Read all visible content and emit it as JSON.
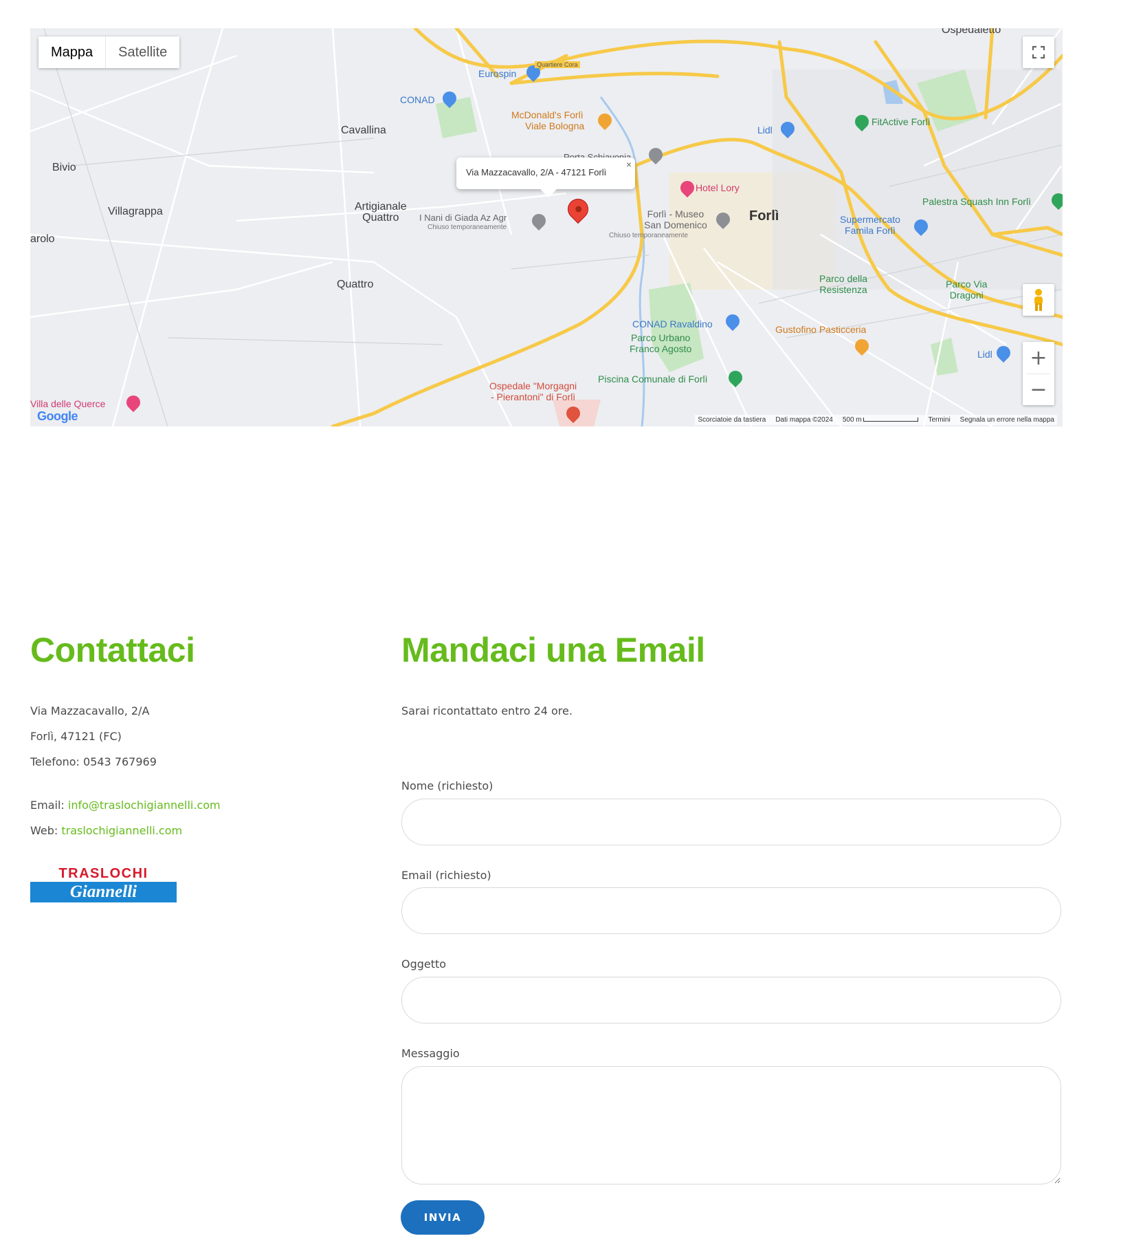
{
  "map": {
    "type_buttons": {
      "map": "Mappa",
      "satellite": "Satellite"
    },
    "info_window": "Via Mazzacavallo, 2/A - 47121 Forlì",
    "close_glyph": "×",
    "labels": {
      "ospedaletto": "Ospedaletto",
      "eurospin": "Eurospin",
      "conad": "CONAD",
      "mcdonalds_1": "McDonald's Forlì",
      "mcdonalds_2": "Viale Bologna",
      "cavallina": "Cavallina",
      "bivio": "Bivio",
      "villagrappa": "Villagrappa",
      "artigianale_1": "Artigianale",
      "artigianale_2": "Quattro",
      "nani": "I Nani di Giada Az Agr",
      "nani_sub": "Chiuso temporaneamente",
      "arolo": "arolo",
      "quattro": "Quattro",
      "porta": "Porta Schiavonia",
      "lidl_1": "Lidl",
      "fitactive": "FitActive Forlì",
      "hotel_lory": "Hotel Lory",
      "forli": "Forlì",
      "museo_1": "Forlì - Museo",
      "museo_2": "San Domenico",
      "museo_sub": "Chiuso temporaneamente",
      "palestra": "Palestra Squash Inn Forlì",
      "supermercato_1": "Supermercato",
      "supermercato_2": "Famila Forlì",
      "parco_res_1": "Parco della",
      "parco_res_2": "Resistenza",
      "parco_via_1": "Parco Via",
      "parco_via_2": "Dragoni",
      "conad_raval": "CONAD Ravaldino",
      "parco_urbano_1": "Parco Urbano",
      "parco_urbano_2": "Franco Agosto",
      "gustofino": "Gustofino Pasticceria",
      "lidl_2": "Lidl",
      "piscina": "Piscina Comunale di Forlì",
      "ospedale_1": "Ospedale \"Morgagni",
      "ospedale_2": "- Pierantoni\" di Forlì",
      "villa": "Villa delle Querce",
      "quartiere": "Quartiere Cora"
    },
    "google": "Google",
    "attribution": {
      "shortcuts": "Scorciatoie da tastiera",
      "data": "Dati mappa ©2024",
      "scale": "500 m",
      "terms": "Termini",
      "report": "Segnala un errore nella mappa"
    },
    "zoom_in": "+",
    "zoom_out": "−"
  },
  "contact": {
    "title": "Contattaci",
    "address_line1": "Via Mazzacavallo, 2/A",
    "address_line2": "Forlì, 47121 (FC)",
    "phone": "Telefono: 0543 767969",
    "email_label": "Email: ",
    "email": "info@traslochigiannelli.com",
    "web_label": "Web: ",
    "web": "traslochigiannelli.com",
    "logo_top": "TRASLOCHI",
    "logo_bottom": "Giannelli"
  },
  "form": {
    "title": "Mandaci una Email",
    "intro": "Sarai ricontattato entro 24 ore.",
    "name_label": "Nome (richiesto)",
    "email_label": "Email (richiesto)",
    "subject_label": "Oggetto",
    "message_label": "Messaggio",
    "submit": "INVIA"
  },
  "colors": {
    "accent_green": "#66bb1c",
    "button_blue": "#1d70bd",
    "logo_red": "#d6192a",
    "logo_blue": "#1b86d3"
  }
}
